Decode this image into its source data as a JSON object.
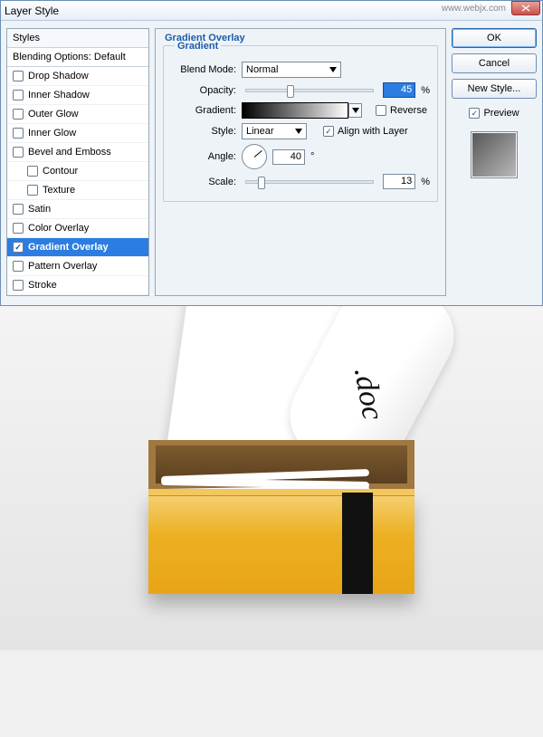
{
  "window": {
    "title": "Layer Style",
    "watermark": "www.webjx.com"
  },
  "styles_panel": {
    "header": "Styles",
    "subheader": "Blending Options: Default",
    "items": [
      {
        "label": "Drop Shadow",
        "checked": false,
        "indent": false
      },
      {
        "label": "Inner Shadow",
        "checked": false,
        "indent": false
      },
      {
        "label": "Outer Glow",
        "checked": false,
        "indent": false
      },
      {
        "label": "Inner Glow",
        "checked": false,
        "indent": false
      },
      {
        "label": "Bevel and Emboss",
        "checked": false,
        "indent": false
      },
      {
        "label": "Contour",
        "checked": false,
        "indent": true
      },
      {
        "label": "Texture",
        "checked": false,
        "indent": true
      },
      {
        "label": "Satin",
        "checked": false,
        "indent": false
      },
      {
        "label": "Color Overlay",
        "checked": false,
        "indent": false
      },
      {
        "label": "Gradient Overlay",
        "checked": true,
        "indent": false,
        "selected": true
      },
      {
        "label": "Pattern Overlay",
        "checked": false,
        "indent": false
      },
      {
        "label": "Stroke",
        "checked": false,
        "indent": false
      }
    ]
  },
  "center": {
    "group_title": "Gradient Overlay",
    "legend": "Gradient",
    "blend_mode_label": "Blend Mode:",
    "blend_mode_value": "Normal",
    "opacity_label": "Opacity:",
    "opacity_value": "45",
    "opacity_unit": "%",
    "opacity_slider_pct": 45,
    "gradient_label": "Gradient:",
    "reverse_label": "Reverse",
    "reverse_checked": false,
    "style_label": "Style:",
    "style_value": "Linear",
    "align_label": "Align with Layer",
    "align_checked": true,
    "angle_label": "Angle:",
    "angle_value": "40",
    "angle_unit": "°",
    "scale_label": "Scale:",
    "scale_value": "13",
    "scale_unit": "%",
    "scale_slider_pct": 13
  },
  "right": {
    "ok": "OK",
    "cancel": "Cancel",
    "new_style": "New Style...",
    "preview_label": "Preview",
    "preview_checked": true
  },
  "artwork": {
    "doc_text": ".doc"
  }
}
